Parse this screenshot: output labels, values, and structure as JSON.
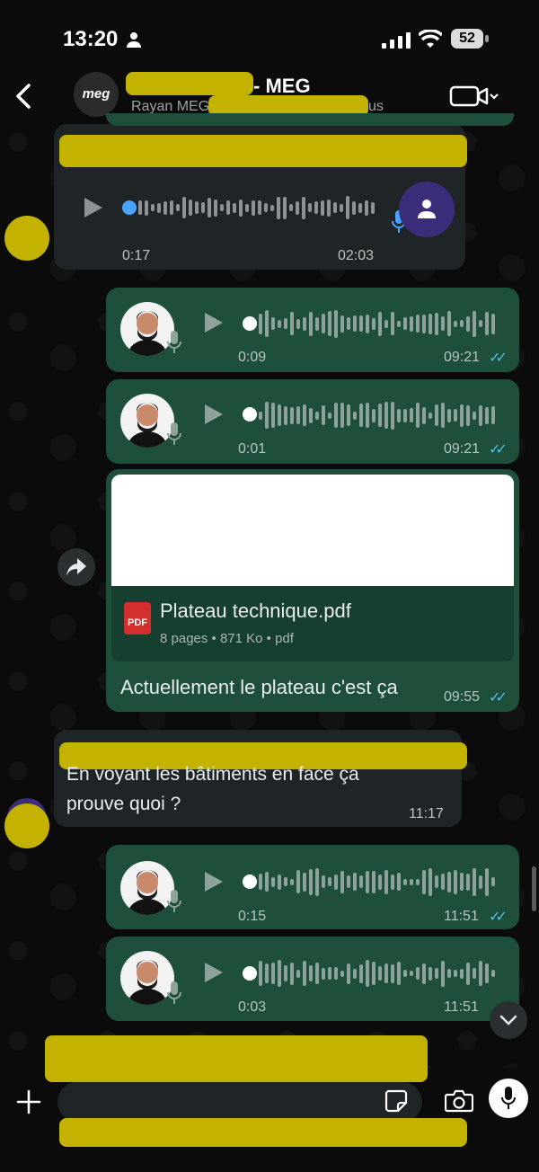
{
  "status_bar": {
    "time": "13:20",
    "battery": "52"
  },
  "header": {
    "title": "- MEG",
    "subtitle_left": "Rayan MEG",
    "subtitle_right": "us",
    "avatar_label": "meg"
  },
  "messages": {
    "voice_in_1": {
      "elapsed": "0:17",
      "time": "02:03"
    },
    "voice_out_1": {
      "duration": "0:09",
      "time": "09:21"
    },
    "voice_out_2": {
      "duration": "0:01",
      "time": "09:21"
    },
    "document": {
      "filename": "Plateau technique.pdf",
      "meta": "8 pages • 871 Ko • pdf",
      "icon_label": "PDF",
      "caption": "Actuellement le plateau c'est ça",
      "time": "09:55"
    },
    "text_in": {
      "line1": "En voyant les bâtiments en face ça",
      "line2": "prouve quoi ?",
      "time": "11:17"
    },
    "voice_out_3": {
      "duration": "0:15",
      "time": "11:51"
    },
    "voice_out_4": {
      "duration": "0:03",
      "time": "11:51"
    }
  },
  "colors": {
    "accent_read": "#53bdeb",
    "bubble_out": "#1d4f3a",
    "bubble_in": "#1f2427",
    "redaction": "#c4b200"
  }
}
